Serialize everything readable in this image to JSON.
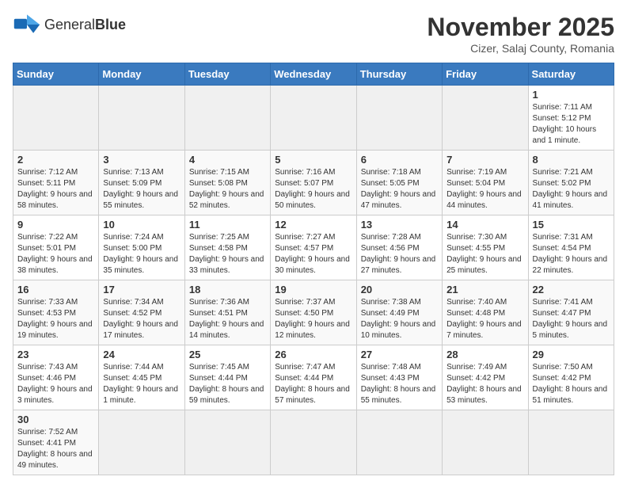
{
  "header": {
    "logo_text_normal": "General",
    "logo_text_bold": "Blue",
    "title": "November 2025",
    "subtitle": "Cizer, Salaj County, Romania"
  },
  "days_of_week": [
    "Sunday",
    "Monday",
    "Tuesday",
    "Wednesday",
    "Thursday",
    "Friday",
    "Saturday"
  ],
  "weeks": [
    [
      {
        "day": null
      },
      {
        "day": null
      },
      {
        "day": null
      },
      {
        "day": null
      },
      {
        "day": null
      },
      {
        "day": null
      },
      {
        "day": 1,
        "info": "Sunrise: 7:11 AM\nSunset: 5:12 PM\nDaylight: 10 hours and 1 minute."
      }
    ],
    [
      {
        "day": 2,
        "info": "Sunrise: 7:12 AM\nSunset: 5:11 PM\nDaylight: 9 hours and 58 minutes."
      },
      {
        "day": 3,
        "info": "Sunrise: 7:13 AM\nSunset: 5:09 PM\nDaylight: 9 hours and 55 minutes."
      },
      {
        "day": 4,
        "info": "Sunrise: 7:15 AM\nSunset: 5:08 PM\nDaylight: 9 hours and 52 minutes."
      },
      {
        "day": 5,
        "info": "Sunrise: 7:16 AM\nSunset: 5:07 PM\nDaylight: 9 hours and 50 minutes."
      },
      {
        "day": 6,
        "info": "Sunrise: 7:18 AM\nSunset: 5:05 PM\nDaylight: 9 hours and 47 minutes."
      },
      {
        "day": 7,
        "info": "Sunrise: 7:19 AM\nSunset: 5:04 PM\nDaylight: 9 hours and 44 minutes."
      },
      {
        "day": 8,
        "info": "Sunrise: 7:21 AM\nSunset: 5:02 PM\nDaylight: 9 hours and 41 minutes."
      }
    ],
    [
      {
        "day": 9,
        "info": "Sunrise: 7:22 AM\nSunset: 5:01 PM\nDaylight: 9 hours and 38 minutes."
      },
      {
        "day": 10,
        "info": "Sunrise: 7:24 AM\nSunset: 5:00 PM\nDaylight: 9 hours and 35 minutes."
      },
      {
        "day": 11,
        "info": "Sunrise: 7:25 AM\nSunset: 4:58 PM\nDaylight: 9 hours and 33 minutes."
      },
      {
        "day": 12,
        "info": "Sunrise: 7:27 AM\nSunset: 4:57 PM\nDaylight: 9 hours and 30 minutes."
      },
      {
        "day": 13,
        "info": "Sunrise: 7:28 AM\nSunset: 4:56 PM\nDaylight: 9 hours and 27 minutes."
      },
      {
        "day": 14,
        "info": "Sunrise: 7:30 AM\nSunset: 4:55 PM\nDaylight: 9 hours and 25 minutes."
      },
      {
        "day": 15,
        "info": "Sunrise: 7:31 AM\nSunset: 4:54 PM\nDaylight: 9 hours and 22 minutes."
      }
    ],
    [
      {
        "day": 16,
        "info": "Sunrise: 7:33 AM\nSunset: 4:53 PM\nDaylight: 9 hours and 19 minutes."
      },
      {
        "day": 17,
        "info": "Sunrise: 7:34 AM\nSunset: 4:52 PM\nDaylight: 9 hours and 17 minutes."
      },
      {
        "day": 18,
        "info": "Sunrise: 7:36 AM\nSunset: 4:51 PM\nDaylight: 9 hours and 14 minutes."
      },
      {
        "day": 19,
        "info": "Sunrise: 7:37 AM\nSunset: 4:50 PM\nDaylight: 9 hours and 12 minutes."
      },
      {
        "day": 20,
        "info": "Sunrise: 7:38 AM\nSunset: 4:49 PM\nDaylight: 9 hours and 10 minutes."
      },
      {
        "day": 21,
        "info": "Sunrise: 7:40 AM\nSunset: 4:48 PM\nDaylight: 9 hours and 7 minutes."
      },
      {
        "day": 22,
        "info": "Sunrise: 7:41 AM\nSunset: 4:47 PM\nDaylight: 9 hours and 5 minutes."
      }
    ],
    [
      {
        "day": 23,
        "info": "Sunrise: 7:43 AM\nSunset: 4:46 PM\nDaylight: 9 hours and 3 minutes."
      },
      {
        "day": 24,
        "info": "Sunrise: 7:44 AM\nSunset: 4:45 PM\nDaylight: 9 hours and 1 minute."
      },
      {
        "day": 25,
        "info": "Sunrise: 7:45 AM\nSunset: 4:44 PM\nDaylight: 8 hours and 59 minutes."
      },
      {
        "day": 26,
        "info": "Sunrise: 7:47 AM\nSunset: 4:44 PM\nDaylight: 8 hours and 57 minutes."
      },
      {
        "day": 27,
        "info": "Sunrise: 7:48 AM\nSunset: 4:43 PM\nDaylight: 8 hours and 55 minutes."
      },
      {
        "day": 28,
        "info": "Sunrise: 7:49 AM\nSunset: 4:42 PM\nDaylight: 8 hours and 53 minutes."
      },
      {
        "day": 29,
        "info": "Sunrise: 7:50 AM\nSunset: 4:42 PM\nDaylight: 8 hours and 51 minutes."
      }
    ],
    [
      {
        "day": 30,
        "info": "Sunrise: 7:52 AM\nSunset: 4:41 PM\nDaylight: 8 hours and 49 minutes."
      },
      {
        "day": null
      },
      {
        "day": null
      },
      {
        "day": null
      },
      {
        "day": null
      },
      {
        "day": null
      },
      {
        "day": null
      }
    ]
  ]
}
